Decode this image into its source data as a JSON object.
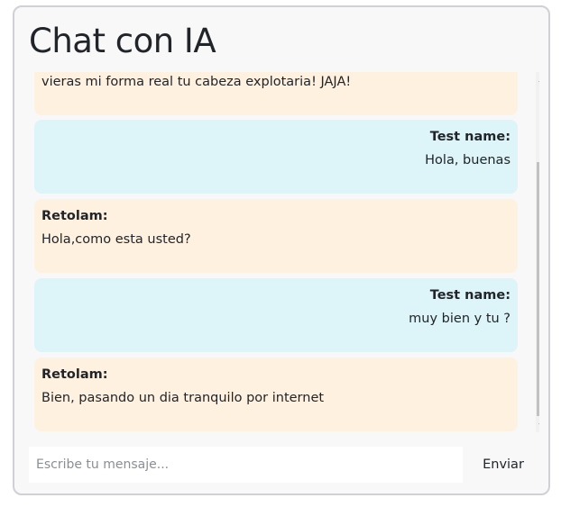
{
  "header": {
    "title": "Chat con IA"
  },
  "messages": [
    {
      "role": "ai",
      "author": "",
      "text": "vieras mi forma real tu cabeza explotaria! JAJA!"
    },
    {
      "role": "user",
      "author": "Test name:",
      "text": "Hola, buenas"
    },
    {
      "role": "ai",
      "author": "Retolam:",
      "text": "Hola,como esta usted?"
    },
    {
      "role": "user",
      "author": "Test name:",
      "text": "muy bien y tu ?"
    },
    {
      "role": "ai",
      "author": "Retolam:",
      "text": "Bien, pasando un dia tranquilo por internet"
    }
  ],
  "composer": {
    "placeholder": "Escribe tu mensaje...",
    "value": "",
    "send_label": "Enviar"
  },
  "colors": {
    "ai_bubble": "#fff1e0",
    "user_bubble": "#ddf5f8",
    "scroll_thumb": "#c1c1c1"
  },
  "icons": {
    "scroll_up": "chevron-up-icon",
    "scroll_down": "chevron-down-icon"
  }
}
